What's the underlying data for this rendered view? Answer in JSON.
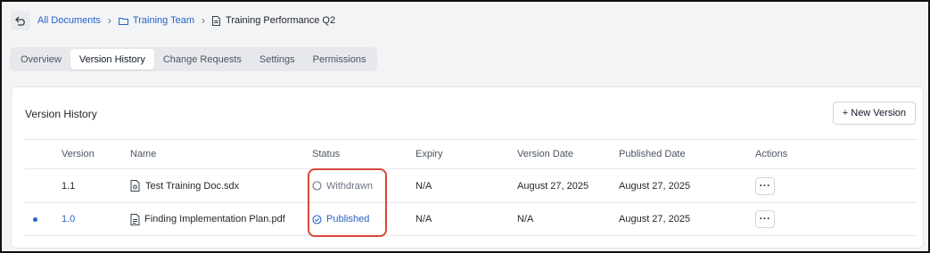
{
  "breadcrumb": {
    "root": "All Documents",
    "folder": "Training Team",
    "current": "Training Performance Q2"
  },
  "tabs": [
    {
      "label": "Overview",
      "active": false
    },
    {
      "label": "Version History",
      "active": true
    },
    {
      "label": "Change Requests",
      "active": false
    },
    {
      "label": "Settings",
      "active": false
    },
    {
      "label": "Permissions",
      "active": false
    }
  ],
  "panel": {
    "title": "Version History",
    "new_button": "+ New Version"
  },
  "table": {
    "headers": {
      "version": "Version",
      "name": "Name",
      "status": "Status",
      "expiry": "Expiry",
      "version_date": "Version Date",
      "published_date": "Published Date",
      "actions": "Actions"
    },
    "rows": [
      {
        "version": "1.1",
        "name": "Test Training Doc.sdx",
        "file_icon": "file-gear-icon",
        "status": "Withdrawn",
        "status_icon": "circle-outline-icon",
        "expiry": "N/A",
        "version_date": "August 27, 2025",
        "published_date": "August 27, 2025",
        "actions": "···",
        "current": false
      },
      {
        "version": "1.0",
        "name": "Finding Implementation Plan.pdf",
        "file_icon": "file-text-icon",
        "status": "Published",
        "status_icon": "check-circle-icon",
        "expiry": "N/A",
        "version_date": "N/A",
        "published_date": "August 27, 2025",
        "actions": "···",
        "current": true
      }
    ]
  },
  "colors": {
    "link": "#2563c9",
    "highlight": "#d9463c",
    "muted": "#6b7280"
  }
}
